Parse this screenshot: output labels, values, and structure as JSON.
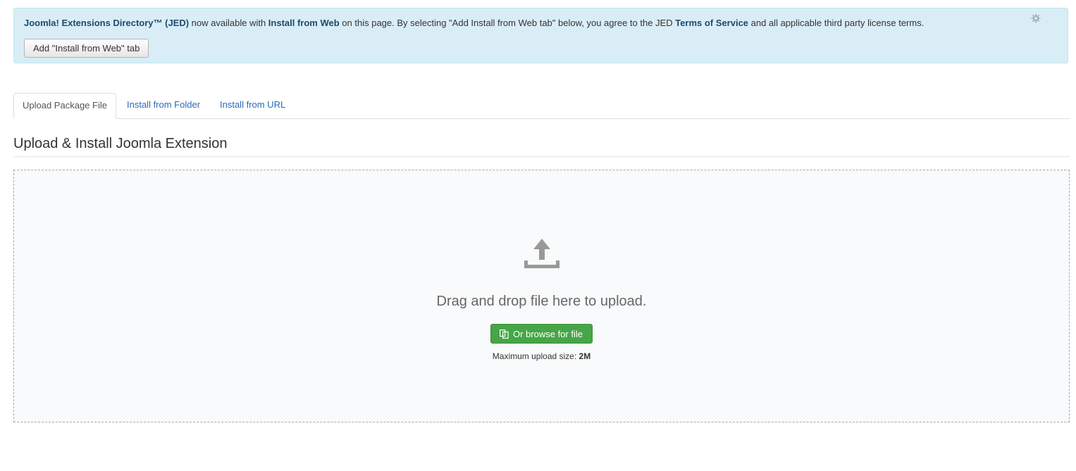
{
  "notice": {
    "jed_label": "Joomla! Extensions Directory™ (JED)",
    "text_1": " now available with ",
    "install_from_web_label": "Install from Web",
    "text_2": " on this page. By selecting \"Add Install from Web tab\" below, you agree to the JED ",
    "terms_label": "Terms of Service",
    "text_3": " and all applicable third party license terms.",
    "button_label": "Add \"Install from Web\" tab",
    "settings_icon": "gear-icon"
  },
  "tabs": [
    {
      "label": "Upload Package File",
      "active": true
    },
    {
      "label": "Install from Folder",
      "active": false
    },
    {
      "label": "Install from URL",
      "active": false
    }
  ],
  "section": {
    "title": "Upload & Install Joomla Extension"
  },
  "dropzone": {
    "icon": "upload-icon",
    "drag_text": "Drag and drop file here to upload.",
    "browse_label": "Or browse for file",
    "browse_icon": "copy-icon",
    "max_label": "Maximum upload size: ",
    "max_value": "2M"
  },
  "colors": {
    "alert_bg": "#d9edf7",
    "link": "#2a69b8",
    "success": "#46a546"
  }
}
